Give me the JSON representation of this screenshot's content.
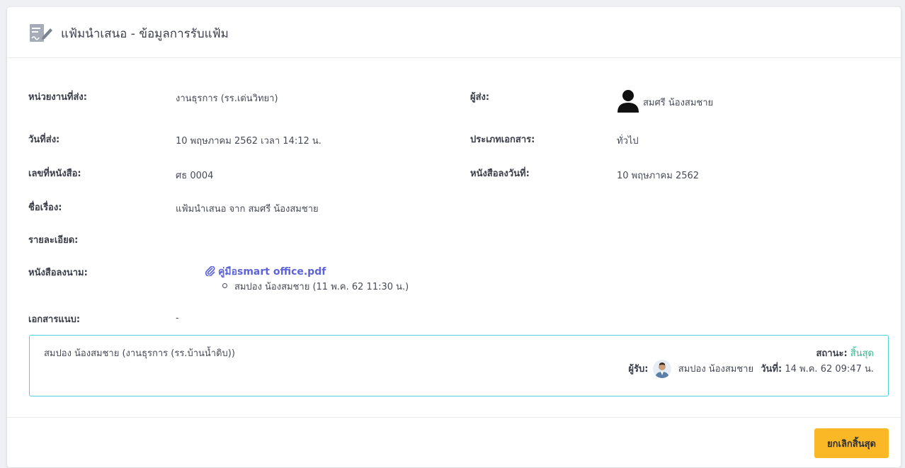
{
  "header": {
    "icon": "document-sign-icon",
    "title": "แฟ้มนำเสนอ - ข้อมูลการรับแฟ้ม"
  },
  "details": {
    "department": {
      "label": "หน่วยงานที่ส่ง:",
      "value": "งานธุรการ (รร.เด่นวิทยา)"
    },
    "sender": {
      "label": "ผู้ส่ง:",
      "value": "สมศรี น้องสมชาย",
      "avatar_icon": "user-silhouette-icon"
    },
    "send_date": {
      "label": "วันที่ส่ง:",
      "value": "10 พฤษภาคม 2562 เวลา 14:12 น."
    },
    "doc_type": {
      "label": "ประเภทเอกสาร:",
      "value": "ทั่วไป"
    },
    "doc_number": {
      "label": "เลขที่หนังสือ:",
      "value": "ศธ 0004"
    },
    "doc_date": {
      "label": "หนังสือลงวันที่:",
      "value": "10 พฤษภาคม 2562"
    },
    "subject": {
      "label": "ชื่อเรื่อง:",
      "value": "แฟ้มนำเสนอ จาก สมศรี น้องสมชาย"
    },
    "description": {
      "label": "รายละเอียด:",
      "value": ""
    },
    "signed_doc": {
      "label": "หนังสือลงนาม:",
      "file_name": "คู่มือsmart office.pdf",
      "file_icon": "paperclip-icon",
      "signer": "สมปอง น้องสมชาย (11 พ.ค. 62 11:30 น.)"
    },
    "attachments": {
      "label": "เอกสารแนบ:",
      "value": "-"
    }
  },
  "routing": {
    "from": "สมปอง น้องสมชาย (งานธุรการ (รร.บ้านน้ำดิบ))",
    "status_label": "สถานะ:",
    "status_value": "สิ้นสุด",
    "receiver_label": "ผู้รับ:",
    "receiver_name": "สมปอง น้องสมชาย",
    "date_label": "วันที่:",
    "date_value": "14 พ.ค. 62 09:47 น."
  },
  "footer": {
    "cancel_label": "ยกเลิกสิ้นสุด"
  },
  "colors": {
    "accent_link": "#5d63d9",
    "status_green": "#33b98a",
    "route_border": "#4fd1d9",
    "button_yellow": "#fbb826"
  }
}
